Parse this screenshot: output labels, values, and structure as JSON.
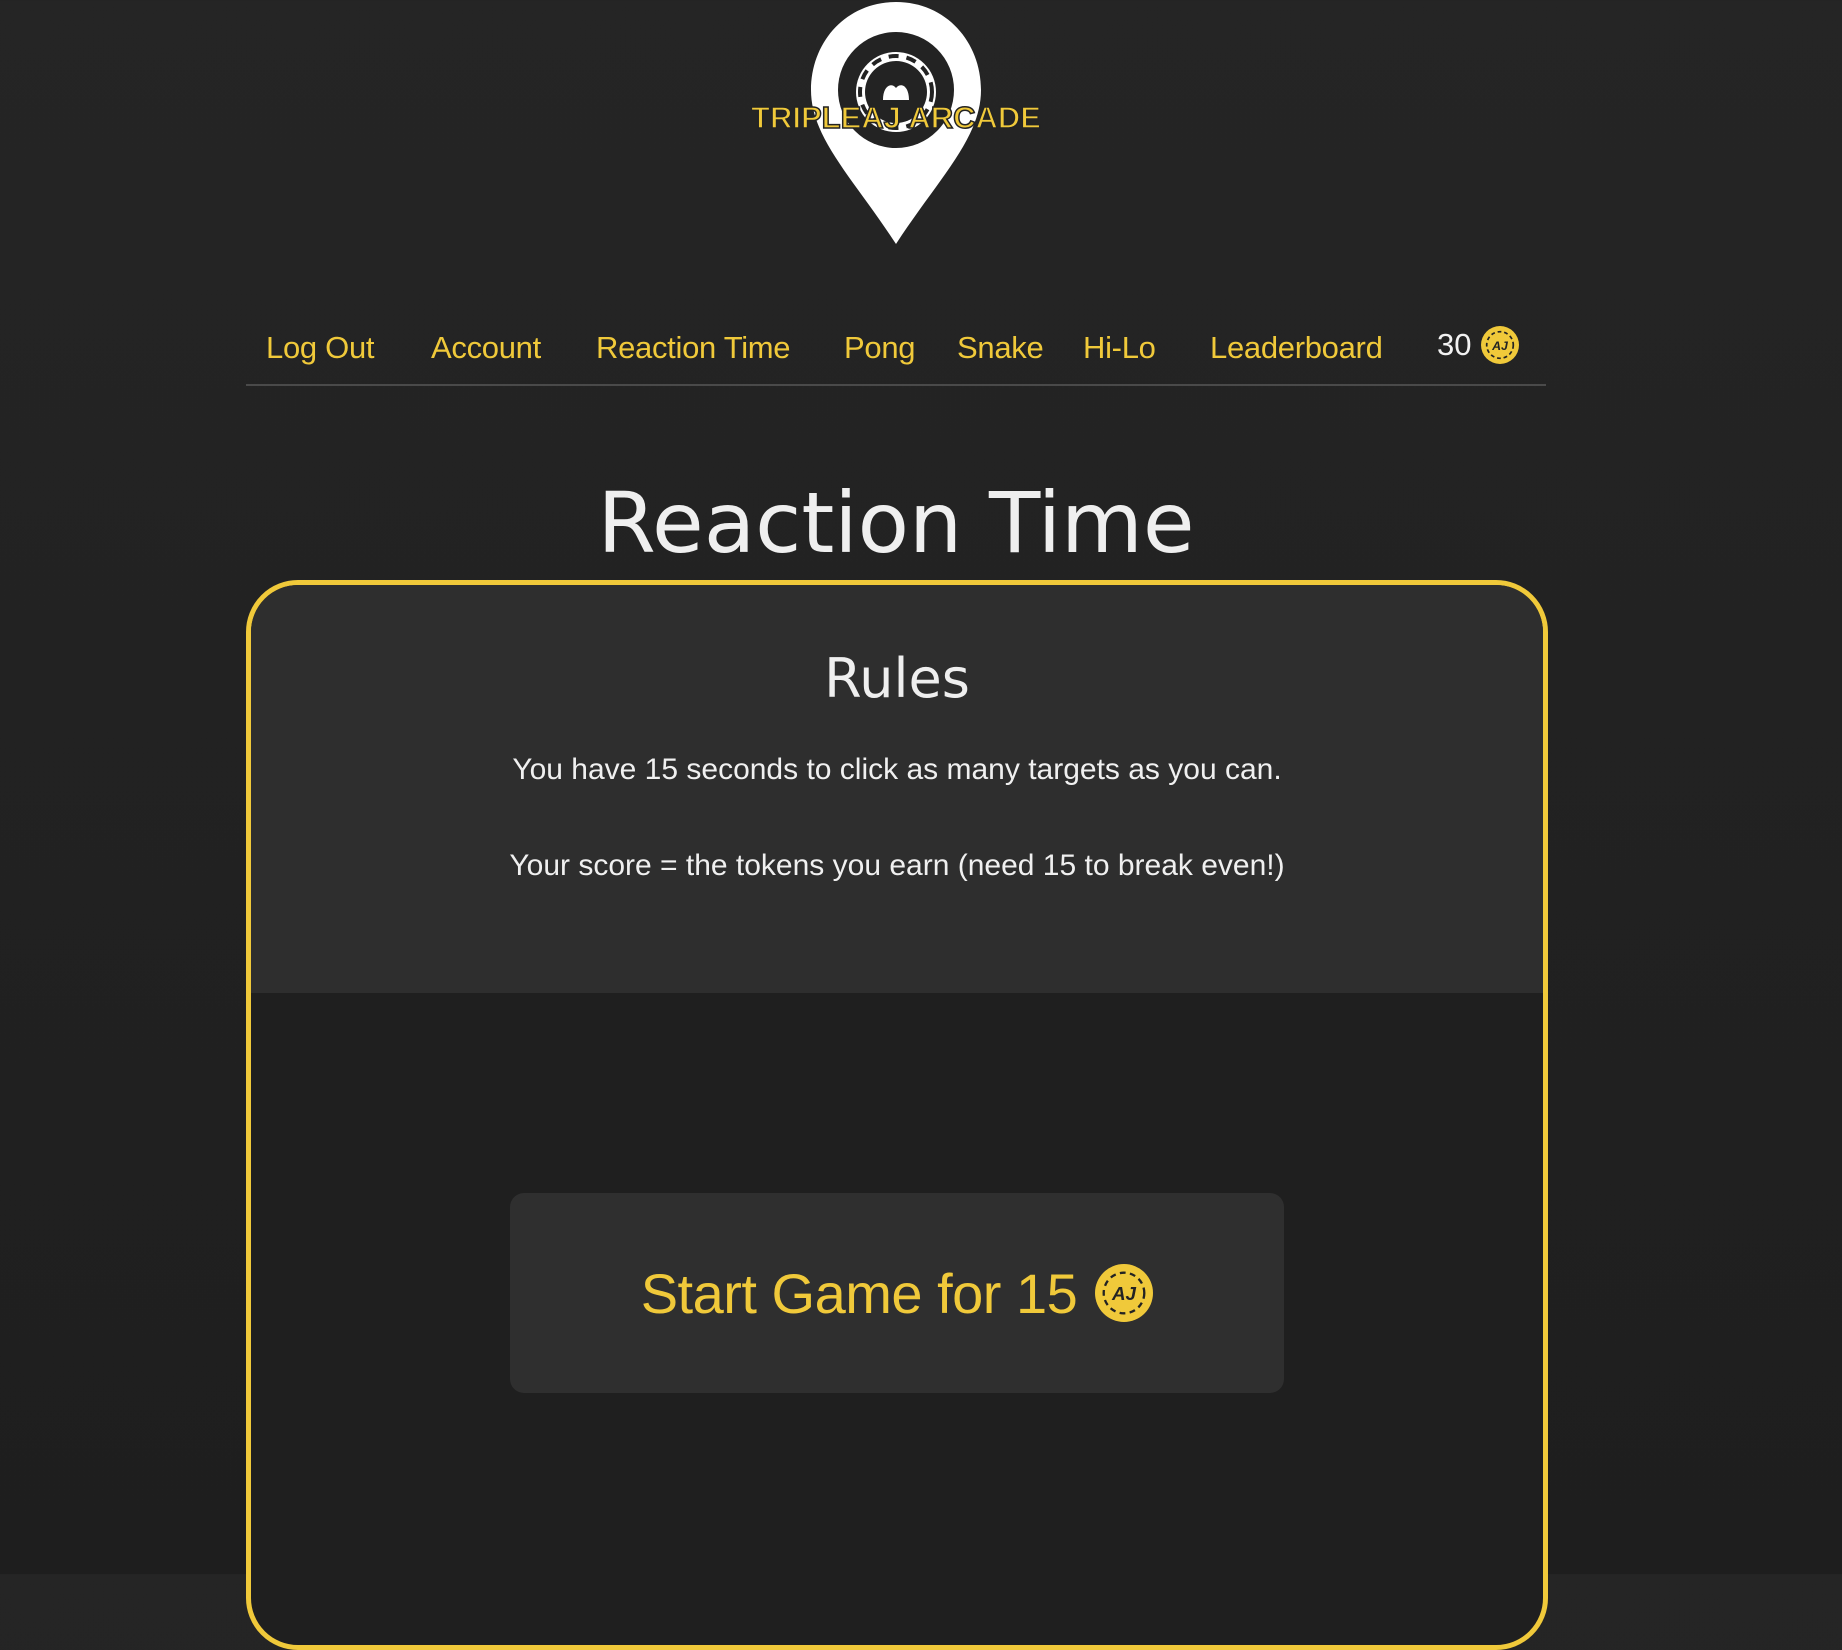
{
  "brand": {
    "name": "TRIPLEAJ ARCADE",
    "colors": {
      "accent": "#f0c93a",
      "background": "#232323",
      "panel": "#2e2e2e",
      "text": "#efefef"
    }
  },
  "nav": {
    "items": [
      {
        "label": "Log Out"
      },
      {
        "label": "Account"
      },
      {
        "label": "Reaction Time"
      },
      {
        "label": "Pong"
      },
      {
        "label": "Snake"
      },
      {
        "label": "Hi-Lo"
      },
      {
        "label": "Leaderboard"
      }
    ],
    "token_balance": "30",
    "token_icon": "aj-token-icon",
    "token_icon_text": "AJ"
  },
  "page": {
    "title": "Reaction Time"
  },
  "rules": {
    "title": "Rules",
    "line1": "You have 15 seconds to click as many targets as you can.",
    "line2": "Your score = the tokens you earn (need 15 to break even!)"
  },
  "start": {
    "label": "Start Game for 15",
    "icon": "aj-token-icon"
  }
}
